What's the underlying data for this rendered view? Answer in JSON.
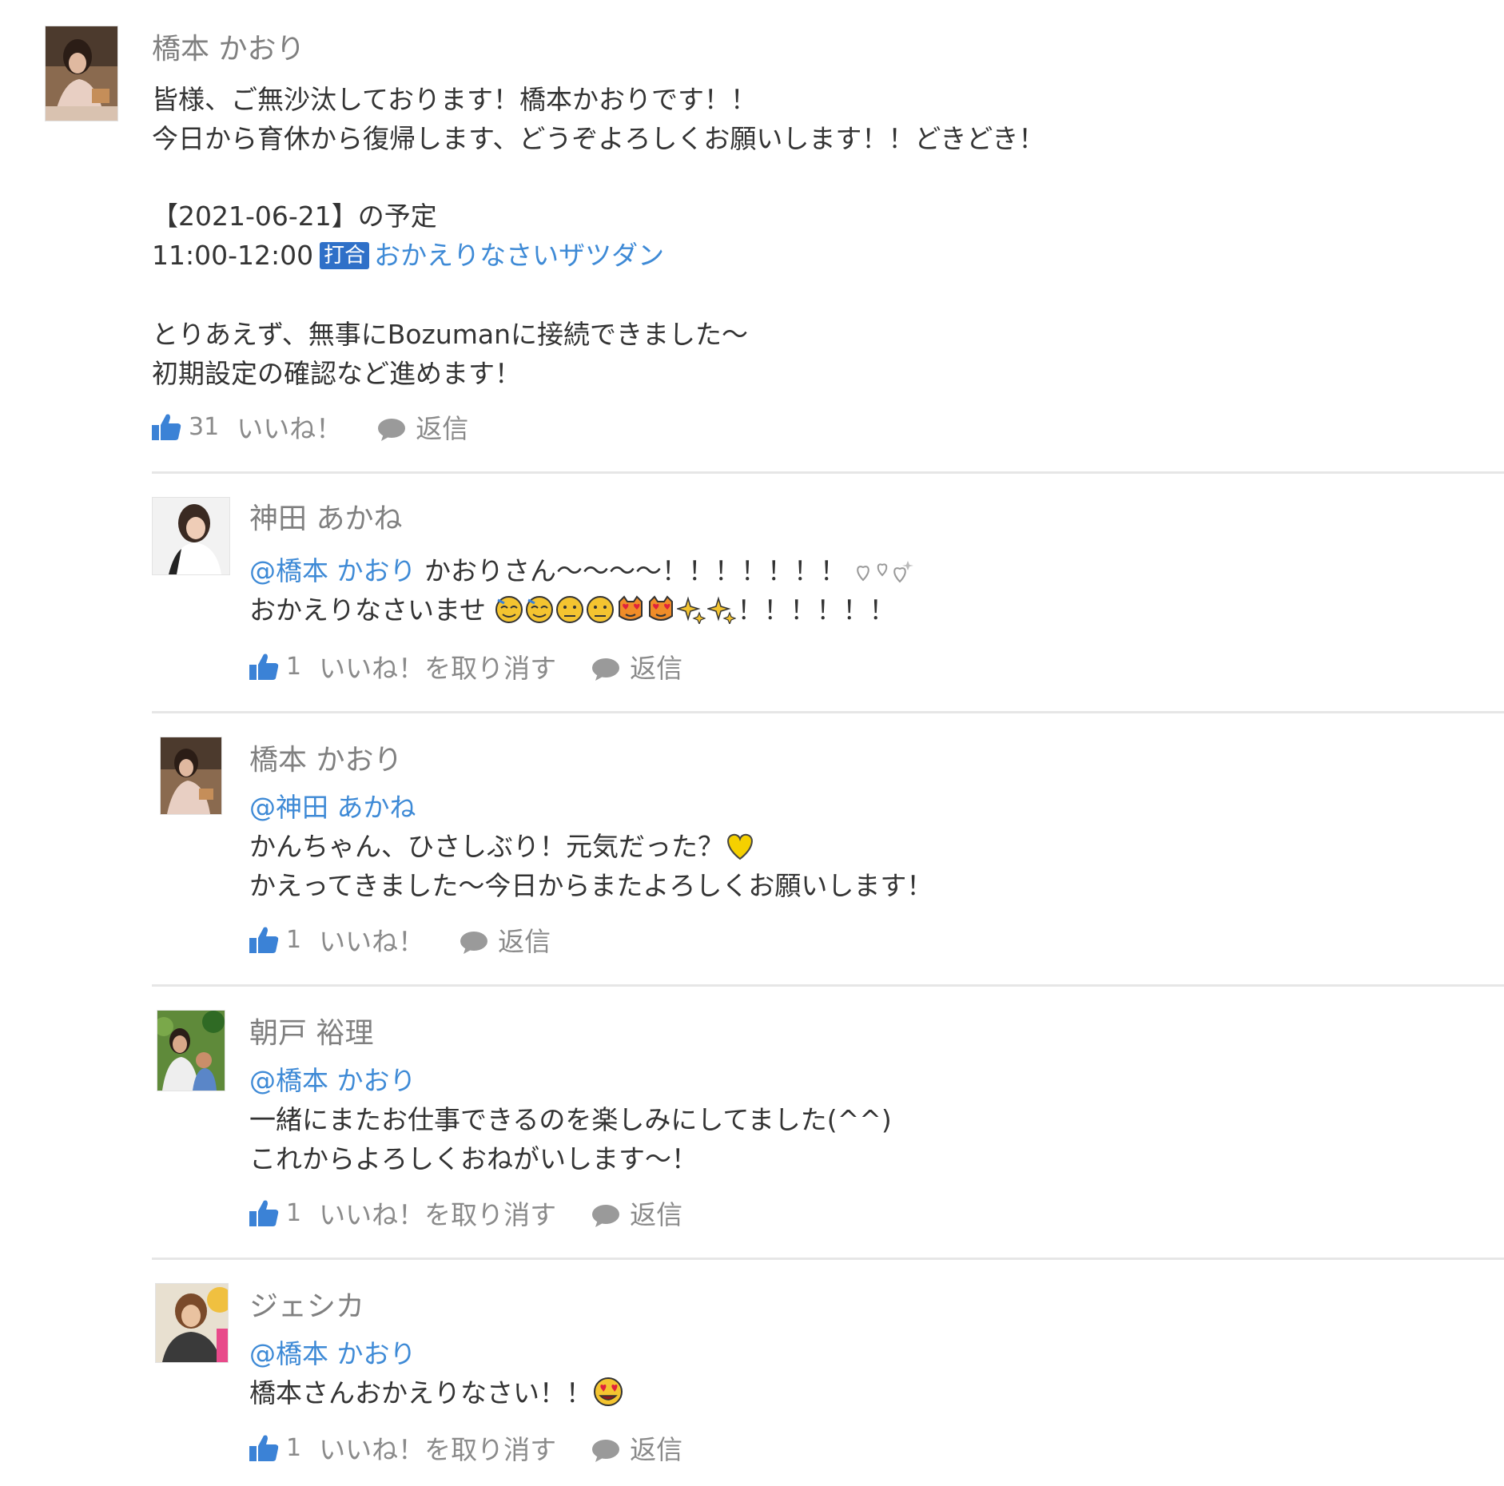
{
  "main_post": {
    "author": "橋本 かおり",
    "lines": [
      "皆様、ご無沙汰しております！橋本かおりです！！",
      "今日から育休から復帰します、どうぞよろしくお願いします！！どきどき！"
    ],
    "schedule_header": "【2021-06-21】の予定",
    "schedule_time": "11:00-12:00",
    "schedule_badge": "打合",
    "schedule_title": "おかえりなさいザツダン",
    "lines2": [
      "とりあえず、無事にBozumanに接続できました～",
      "初期設定の確認など進めます！"
    ],
    "like_count": "31",
    "like_label": "いいね！",
    "reply_label": "返信"
  },
  "comments": [
    {
      "author": "神田 あかね",
      "mention": "@橋本 かおり",
      "first_line_text": "かおりさん～～～～！！！！！！！",
      "second_line_text": "おかえりなさいませ",
      "second_line_tail": "！！！！！！",
      "like_count": "1",
      "like_label": "いいね！を取り消す",
      "reply_label": "返信"
    },
    {
      "author": "橋本 かおり",
      "mention": "@神田 あかね",
      "lines": [
        "かんちゃん、ひさしぶり！元気だった？",
        "かえってきました～今日からまたよろしくお願いします！"
      ],
      "like_count": "1",
      "like_label": "いいね！",
      "reply_label": "返信"
    },
    {
      "author": "朝戸 裕理",
      "mention": "@橋本 かおり",
      "lines": [
        "一緒にまたお仕事できるのを楽しみにしてました(^^)",
        "これからよろしくおねがいします～！"
      ],
      "like_count": "1",
      "like_label": "いいね！を取り消す",
      "reply_label": "返信"
    },
    {
      "author": "ジェシカ",
      "mention": "@橋本 かおり",
      "lines": [
        "橋本さんおかえりなさい！！"
      ],
      "like_count": "1",
      "like_label": "いいね！を取り消す",
      "reply_label": "返信"
    }
  ],
  "icons": {
    "like": "thumbs-up-icon",
    "reply": "speech-bubble-icon"
  },
  "colors": {
    "mention": "#3e8ad6",
    "author": "#808080",
    "badge": "#2f70c8",
    "action_icon": "#3b82d6"
  }
}
